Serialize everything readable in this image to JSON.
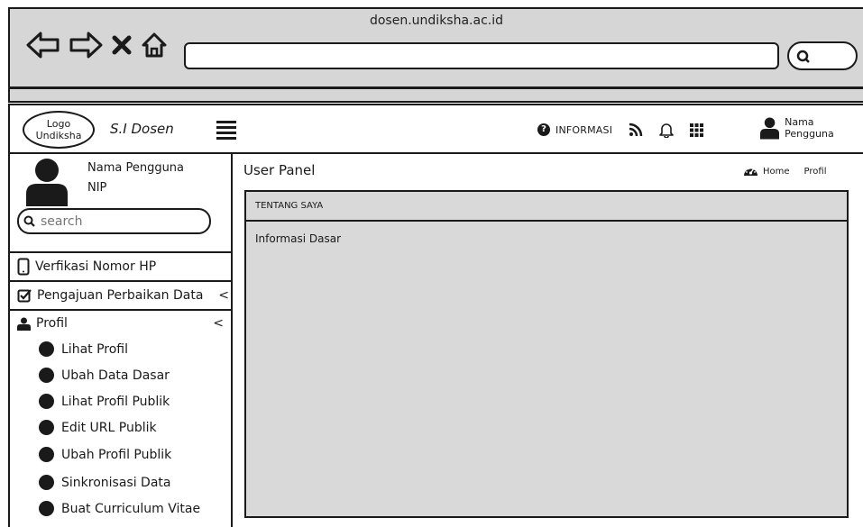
{
  "browser": {
    "url_title": "dosen.undiksha.ac.id",
    "nav_icons": [
      "back-arrow-icon",
      "forward-arrow-icon",
      "close-icon",
      "home-icon"
    ],
    "search_icon": "search-icon"
  },
  "header": {
    "logo_text": "Logo Undiksha",
    "app_name": "S.I Dosen",
    "menu_icon": "hamburger-icon",
    "info_label": "INFORMASI",
    "icons": [
      "rss-icon",
      "bell-icon",
      "apps-grid-icon"
    ],
    "user_name": "Nama Pengguna"
  },
  "sidebar": {
    "user_name": "Nama Pengguna",
    "nip": "NIP",
    "search_placeholder": "search",
    "menu": [
      {
        "label": "Verfikasi Nomor HP",
        "icon": "mobile-phone-icon"
      },
      {
        "label": "Pengajuan Perbaikan Data",
        "icon": "checkbox-icon"
      },
      {
        "label": "Profil",
        "icon": "user-icon"
      }
    ],
    "profil_submenu": [
      "Lihat Profil",
      "Ubah Data Dasar",
      "Lihat Profil Publik",
      "Edit URL Publik",
      "Ubah Profil Publik",
      "Sinkronisasi Data",
      "Buat Curriculum Vitae"
    ],
    "chevron": "<"
  },
  "main": {
    "panel_title": "User Panel",
    "breadcrumb": {
      "home": "Home",
      "current": "Profil",
      "icon": "dashboard-icon"
    },
    "card": {
      "header": "TENTANG SAYA",
      "section_label": "Informasi Dasar"
    }
  }
}
